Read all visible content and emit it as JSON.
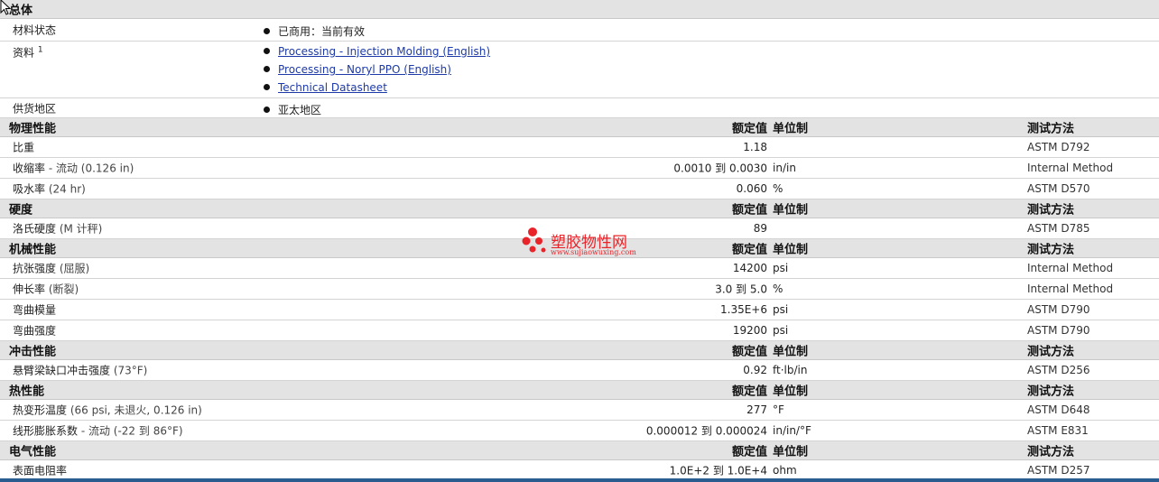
{
  "sections": {
    "general": {
      "title": "总体",
      "material_status": {
        "label": "材料状态",
        "value": "已商用：当前有效"
      },
      "documents": {
        "label": "资料",
        "sup": "1",
        "links": [
          "Processing - Injection Molding (English)",
          "Processing - Noryl PPO (English)",
          "Technical Datasheet"
        ]
      },
      "availability": {
        "label": "供货地区",
        "value": "亚太地区"
      }
    },
    "columns": {
      "value": "额定值",
      "unit": "单位制",
      "test": "测试方法"
    },
    "physical": {
      "title": "物理性能",
      "rows": [
        {
          "name": "比重",
          "cond": "",
          "value": "1.18",
          "unit": "",
          "test": "ASTM D792"
        },
        {
          "name": "收缩率",
          "cond": " - 流动 (0.126 in)",
          "value": "0.0010 到  0.0030",
          "unit": "in/in",
          "test": "Internal Method"
        },
        {
          "name": "吸水率",
          "cond": " (24 hr)",
          "value": "0.060",
          "unit": "%",
          "test": "ASTM D570"
        }
      ]
    },
    "hardness": {
      "title": "硬度",
      "rows": [
        {
          "name": "洛氏硬度",
          "cond": " (M 计秤)",
          "value": "89",
          "unit": "",
          "test": "ASTM D785"
        }
      ]
    },
    "mechanical": {
      "title": "机械性能",
      "rows": [
        {
          "name": "抗张强度",
          "cond": " (屈服)",
          "value": "14200",
          "unit": "psi",
          "test": "Internal Method"
        },
        {
          "name": "伸长率",
          "cond": " (断裂)",
          "value": "3.0 到  5.0",
          "unit": "%",
          "test": "Internal Method"
        },
        {
          "name": "弯曲模量",
          "cond": "",
          "value": "1.35E+6",
          "unit": "psi",
          "test": "ASTM D790"
        },
        {
          "name": "弯曲强度",
          "cond": "",
          "value": "19200",
          "unit": "psi",
          "test": "ASTM D790"
        }
      ]
    },
    "impact": {
      "title": "冲击性能",
      "rows": [
        {
          "name": "悬臂梁缺口冲击强度",
          "cond": " (73°F)",
          "value": "0.92",
          "unit": "ft·lb/in",
          "test": "ASTM D256"
        }
      ]
    },
    "thermal": {
      "title": "热性能",
      "rows": [
        {
          "name": "热变形温度",
          "cond": " (66 psi, 未退火, 0.126 in)",
          "value": "277",
          "unit": "°F",
          "test": "ASTM D648"
        },
        {
          "name": "线形膨胀系数",
          "cond": " - 流动 (-22 到  86°F)",
          "value": "0.000012 到  0.000024",
          "unit": "in/in/°F",
          "test": "ASTM E831"
        }
      ]
    },
    "electrical": {
      "title": "电气性能",
      "rows": [
        {
          "name": "表面电阻率",
          "cond": "",
          "value": "1.0E+2 到  1.0E+4",
          "unit": "ohm",
          "test": "ASTM D257"
        }
      ]
    }
  },
  "watermark": {
    "text": "塑胶物性网",
    "sub": "www.sujiaowuxing.com"
  },
  "colors": {
    "header_bg": "#e3e3e3",
    "link": "#1d3aa8",
    "watermark": "#e8242a",
    "bottom_bar": "#2a5d8f"
  }
}
